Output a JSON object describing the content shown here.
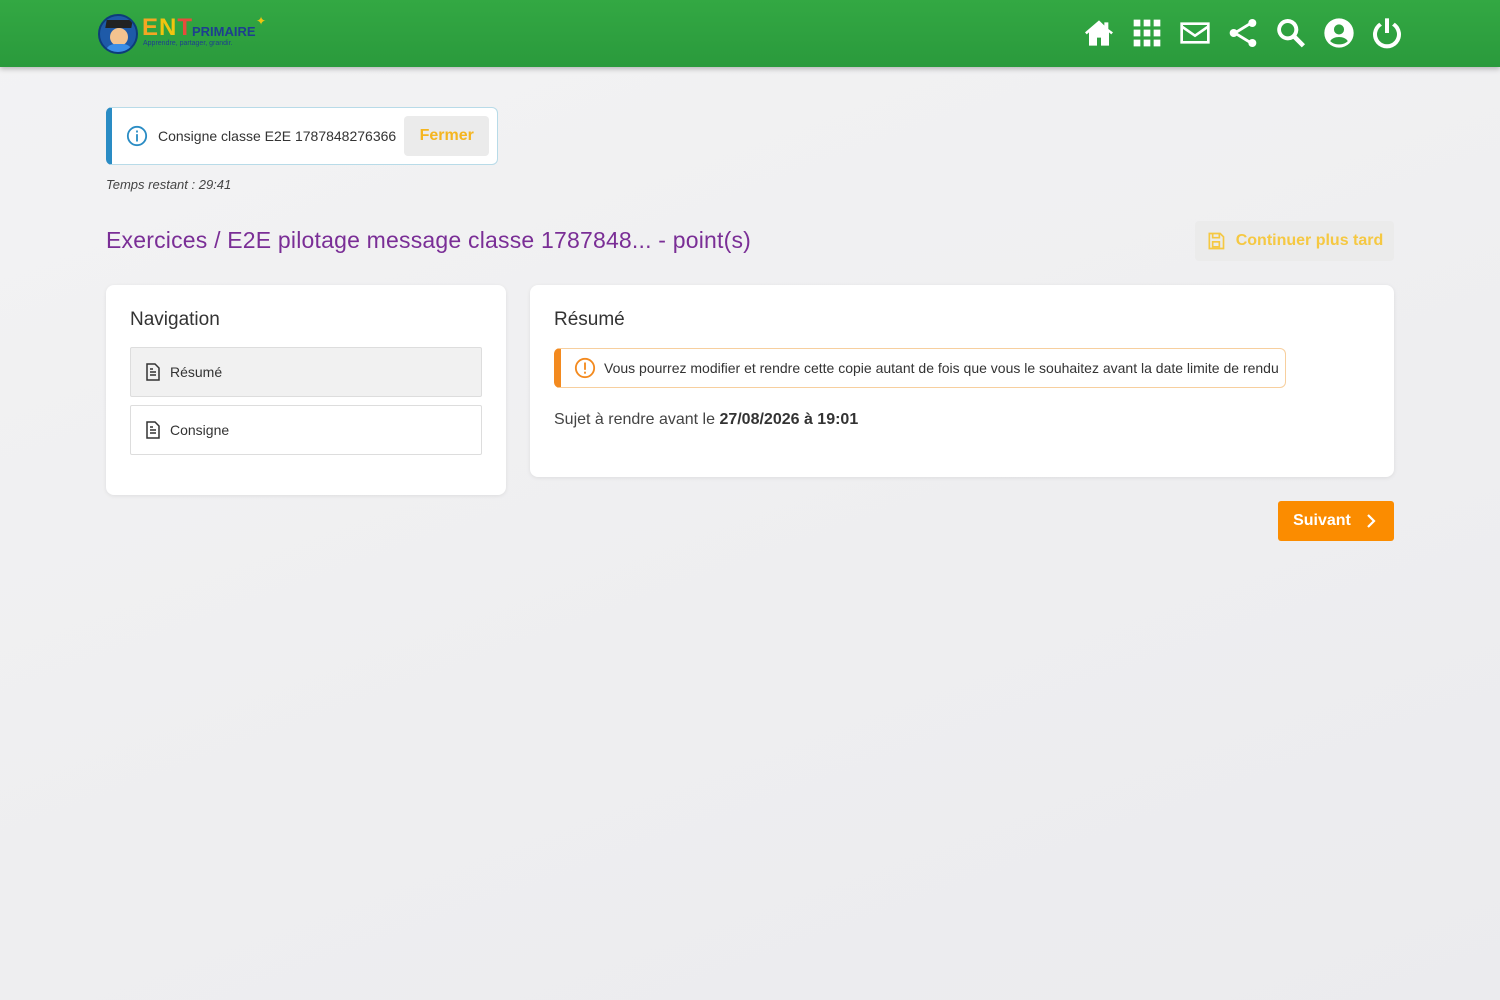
{
  "header": {
    "logo": {
      "brand": "ENT",
      "product": "PRIMAIRE",
      "tagline": "Apprendre, partager, grandir."
    },
    "icons": [
      "home-icon",
      "apps-grid-icon",
      "mail-icon",
      "share-icon",
      "search-icon",
      "account-icon",
      "power-icon"
    ]
  },
  "banner": {
    "text": "Consigne classe E2E 1787848276366",
    "close_label": "Fermer"
  },
  "timer": "Temps restant : 29:41",
  "page": {
    "title": "Exercices / E2E pilotage message classe 1787848... -  point(s)",
    "later_label": "Continuer plus tard"
  },
  "navigation": {
    "title": "Navigation",
    "items": [
      {
        "label": "Résumé"
      },
      {
        "label": "Consigne"
      }
    ]
  },
  "summary": {
    "title": "Résumé",
    "warning": "Vous pourrez modifier et rendre cette copie autant de fois que vous le souhaitez avant la date limite de rendu",
    "deadline_prefix": "Sujet à rendre avant le ",
    "deadline_value": "27/08/2026 à 19:01"
  },
  "next_label": "Suivant",
  "colors": {
    "header": "#2ea541",
    "title": "#7a2e96",
    "accent_orange": "#fb8c00",
    "info_blue": "#2a8cc4",
    "warn_orange": "#f38a1f"
  }
}
